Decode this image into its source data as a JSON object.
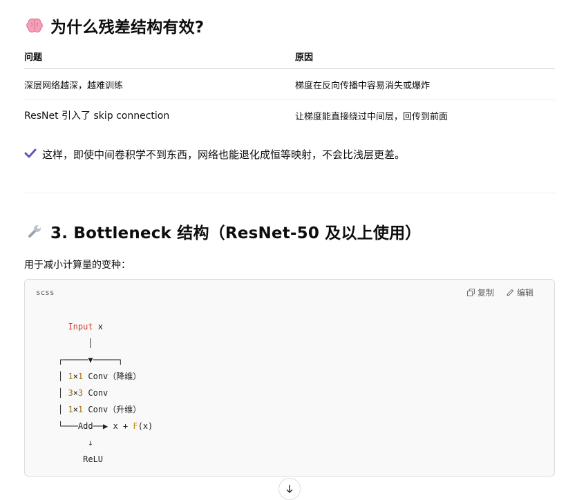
{
  "section_why": {
    "emoji": "brain-icon",
    "title": "为什么残差结构有效?"
  },
  "table": {
    "headers": [
      "问题",
      "原因"
    ],
    "rows": [
      [
        "深层网络越深，越难训练",
        "梯度在反向传播中容易消失或爆炸"
      ],
      [
        "ResNet 引入了 skip connection",
        "让梯度能直接绕过中间层，回传到前面"
      ]
    ]
  },
  "check_line": {
    "icon": "check-icon",
    "text": "这样，即使中间卷积学不到东西，网络也能退化成恒等映射，不会比浅层更差。"
  },
  "section_bottleneck": {
    "emoji": "wrench-icon",
    "title": "3. Bottleneck 结构（ResNet-50 及以上使用）",
    "intro": "用于减小计算量的变种："
  },
  "code": {
    "language": "scss",
    "copy_label": "复制",
    "edit_label": "编辑",
    "lines": {
      "l1_kw": "Input",
      "l1_rest": " x",
      "l2": "      │",
      "l3": "┌─────▼─────┐",
      "l4_num1": "1",
      "l4_x": "×",
      "l4_num2": "1",
      "l4_rest": " Conv（降维）",
      "l5_num1": "3",
      "l5_x": "×",
      "l5_num2": "3",
      "l5_rest": " Conv",
      "l6_num1": "1",
      "l6_x": "×",
      "l6_num2": "1",
      "l6_rest": " Conv（升维）",
      "l7_pre": "└───Add──▶ x + ",
      "l7_fn": "F",
      "l7_post": "(x)",
      "l8": "      ↓",
      "l9": "     ReLU"
    }
  },
  "scroll_button": {
    "icon": "arrow-down-icon"
  }
}
